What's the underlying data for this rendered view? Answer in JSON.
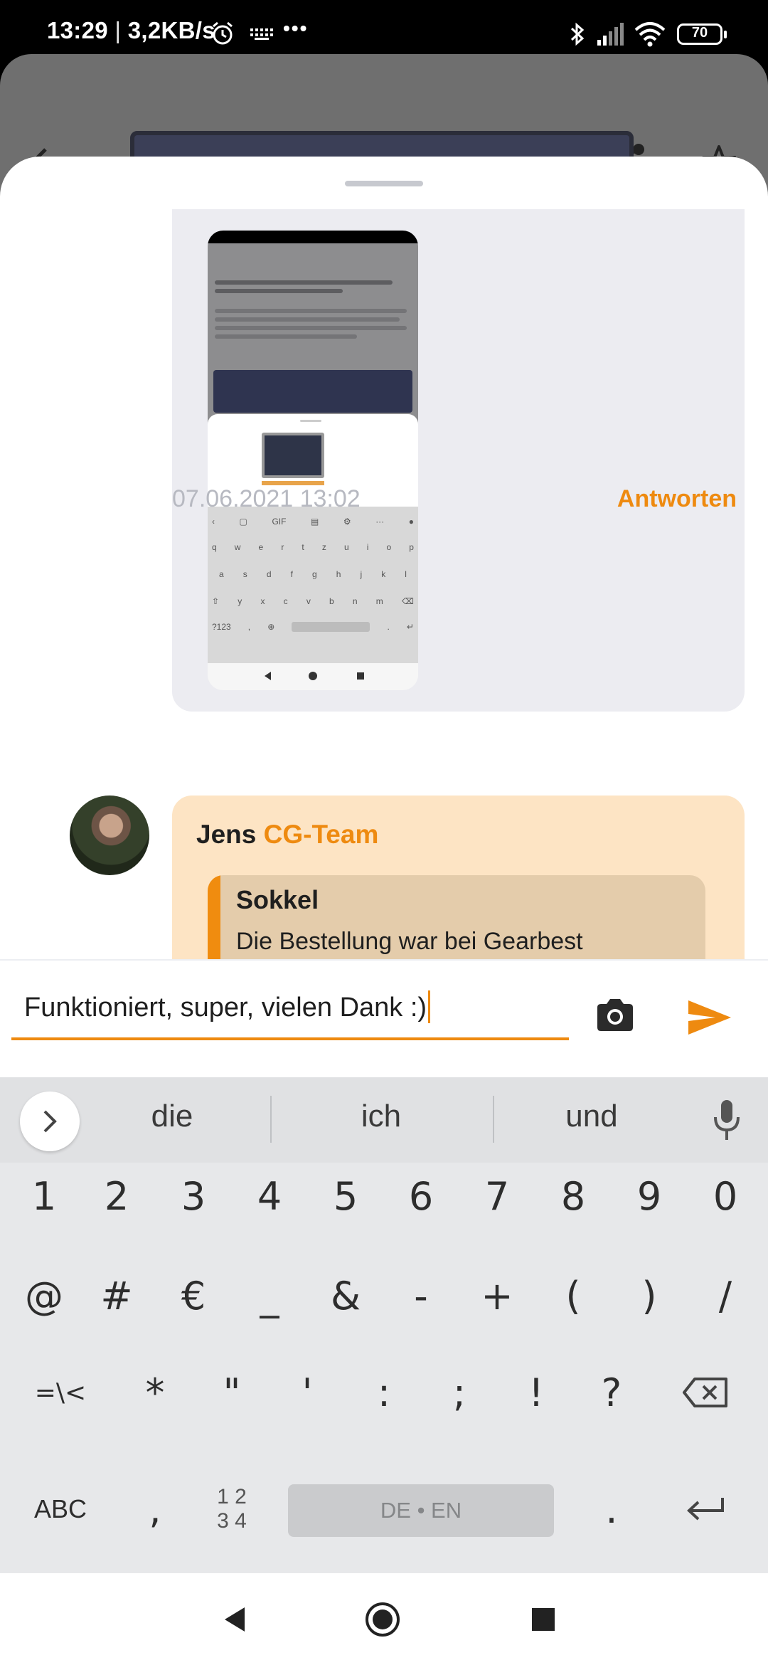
{
  "status_bar": {
    "time": "13:29",
    "speed": "3,2KB/s",
    "more": "•••",
    "battery": "70"
  },
  "message_meta": {
    "timestamp": "07.06.2021 13:02",
    "reply_label": "Antworten"
  },
  "team_message": {
    "author": "Jens",
    "role": "CG-Team",
    "quote_author": "Sokkel",
    "quote_text": "Die Bestellung war bei Gearbest"
  },
  "composer": {
    "text": "Funktioniert, super, vielen Dank :)"
  },
  "keyboard": {
    "suggestions": [
      "die",
      "ich",
      "und"
    ],
    "row1": [
      "1",
      "2",
      "3",
      "4",
      "5",
      "6",
      "7",
      "8",
      "9",
      "0"
    ],
    "row2": [
      "@",
      "#",
      "€",
      "_",
      "&",
      "-",
      "+",
      "(",
      ")",
      "/"
    ],
    "row3": [
      "=\\<",
      "*",
      "\"",
      "'",
      ":",
      ";",
      "!",
      "?"
    ],
    "abc": "ABC",
    "comma": ",",
    "numbers_top": "1 2",
    "numbers_bottom": "3 4",
    "space": "DE • EN",
    "period": "."
  },
  "colors": {
    "accent": "#ee8a10",
    "team_bubble": "#fde4c4",
    "quote_bg": "#e4ccab"
  }
}
